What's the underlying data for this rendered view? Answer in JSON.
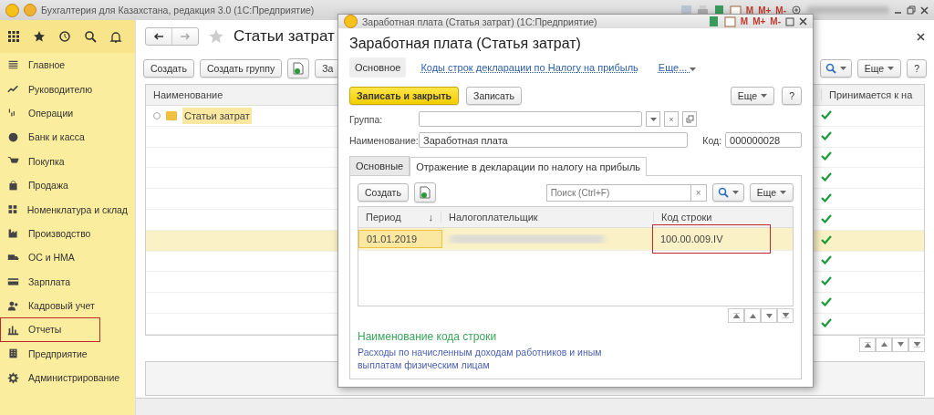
{
  "app": {
    "title": "Бухгалтерия для Казахстана, редакция 3.0  (1С:Предприятие)",
    "memory_keys": [
      "M",
      "M+",
      "M-"
    ]
  },
  "sidebar": {
    "items": [
      {
        "label": "Главное",
        "highlighted": false
      },
      {
        "label": "Руководителю",
        "highlighted": false
      },
      {
        "label": "Операции",
        "highlighted": false
      },
      {
        "label": "Банк и касса",
        "highlighted": false
      },
      {
        "label": "Покупка",
        "highlighted": false
      },
      {
        "label": "Продажа",
        "highlighted": false
      },
      {
        "label": "Номенклатура и склад",
        "highlighted": false
      },
      {
        "label": "Производство",
        "highlighted": false
      },
      {
        "label": "ОС и НМА",
        "highlighted": false
      },
      {
        "label": "Зарплата",
        "highlighted": false
      },
      {
        "label": "Кадровый учет",
        "highlighted": false
      },
      {
        "label": "Отчеты",
        "highlighted": true
      },
      {
        "label": "Предприятие",
        "highlighted": false
      },
      {
        "label": "Администрирование",
        "highlighted": false
      }
    ]
  },
  "main": {
    "title": "Статьи затрат",
    "toolbar": [
      "Создать",
      "Создать группу",
      "За"
    ],
    "more": "Еще",
    "help": "?",
    "columns": [
      "Наименование",
      "Принимается к на"
    ],
    "rows": [
      {
        "name": "Статьи затрат",
        "accepted": true,
        "selected": false
      },
      {
        "accepted": true,
        "selected": false
      },
      {
        "accepted": true,
        "selected": false
      },
      {
        "accepted": true,
        "selected": false
      },
      {
        "accepted": true,
        "selected": false
      },
      {
        "accepted": true,
        "selected": false
      },
      {
        "accepted": true,
        "selected": true
      },
      {
        "accepted": true,
        "selected": false
      },
      {
        "accepted": true,
        "selected": false
      },
      {
        "accepted": true,
        "selected": false
      },
      {
        "accepted": true,
        "selected": false
      }
    ]
  },
  "dialog": {
    "window_title": "Заработная плата (Статья затрат)  (1С:Предприятие)",
    "memory_keys": [
      "M",
      "M+",
      "M-"
    ],
    "heading": "Заработная плата (Статья затрат)",
    "nav": [
      {
        "label": "Основное",
        "selected": true
      },
      {
        "label": "Коды строк декларации по Налогу на прибыль",
        "selected": false
      }
    ],
    "nav_more": "Еще...",
    "save_close": "Записать и закрыть",
    "save": "Записать",
    "more": "Еще",
    "help": "?",
    "group": {
      "label": "Группа:"
    },
    "name": {
      "label": "Наименование:",
      "value": "Заработная плата"
    },
    "code": {
      "label": "Код:",
      "value": "000000028"
    },
    "tabs": [
      {
        "label": "Основные",
        "selected": false
      },
      {
        "label": "Отражение в декларации по налогу на прибыль",
        "selected": true
      }
    ],
    "inner_create": "Создать",
    "search": {
      "placeholder": "Поиск (Ctrl+F)"
    },
    "clear": "×",
    "inner_more": "Еще",
    "columns": [
      "Период",
      "Налогоплательщик",
      "Код строки"
    ],
    "sort_mark": "↓",
    "rows": [
      {
        "period": "01.01.2019",
        "code": "100.00.009.IV",
        "selected": true,
        "code_highlighted": true
      }
    ],
    "caption": "Наименование кода строки",
    "description": "Расходы по начисленным доходам работников и иным выплатам физическим лицам"
  }
}
